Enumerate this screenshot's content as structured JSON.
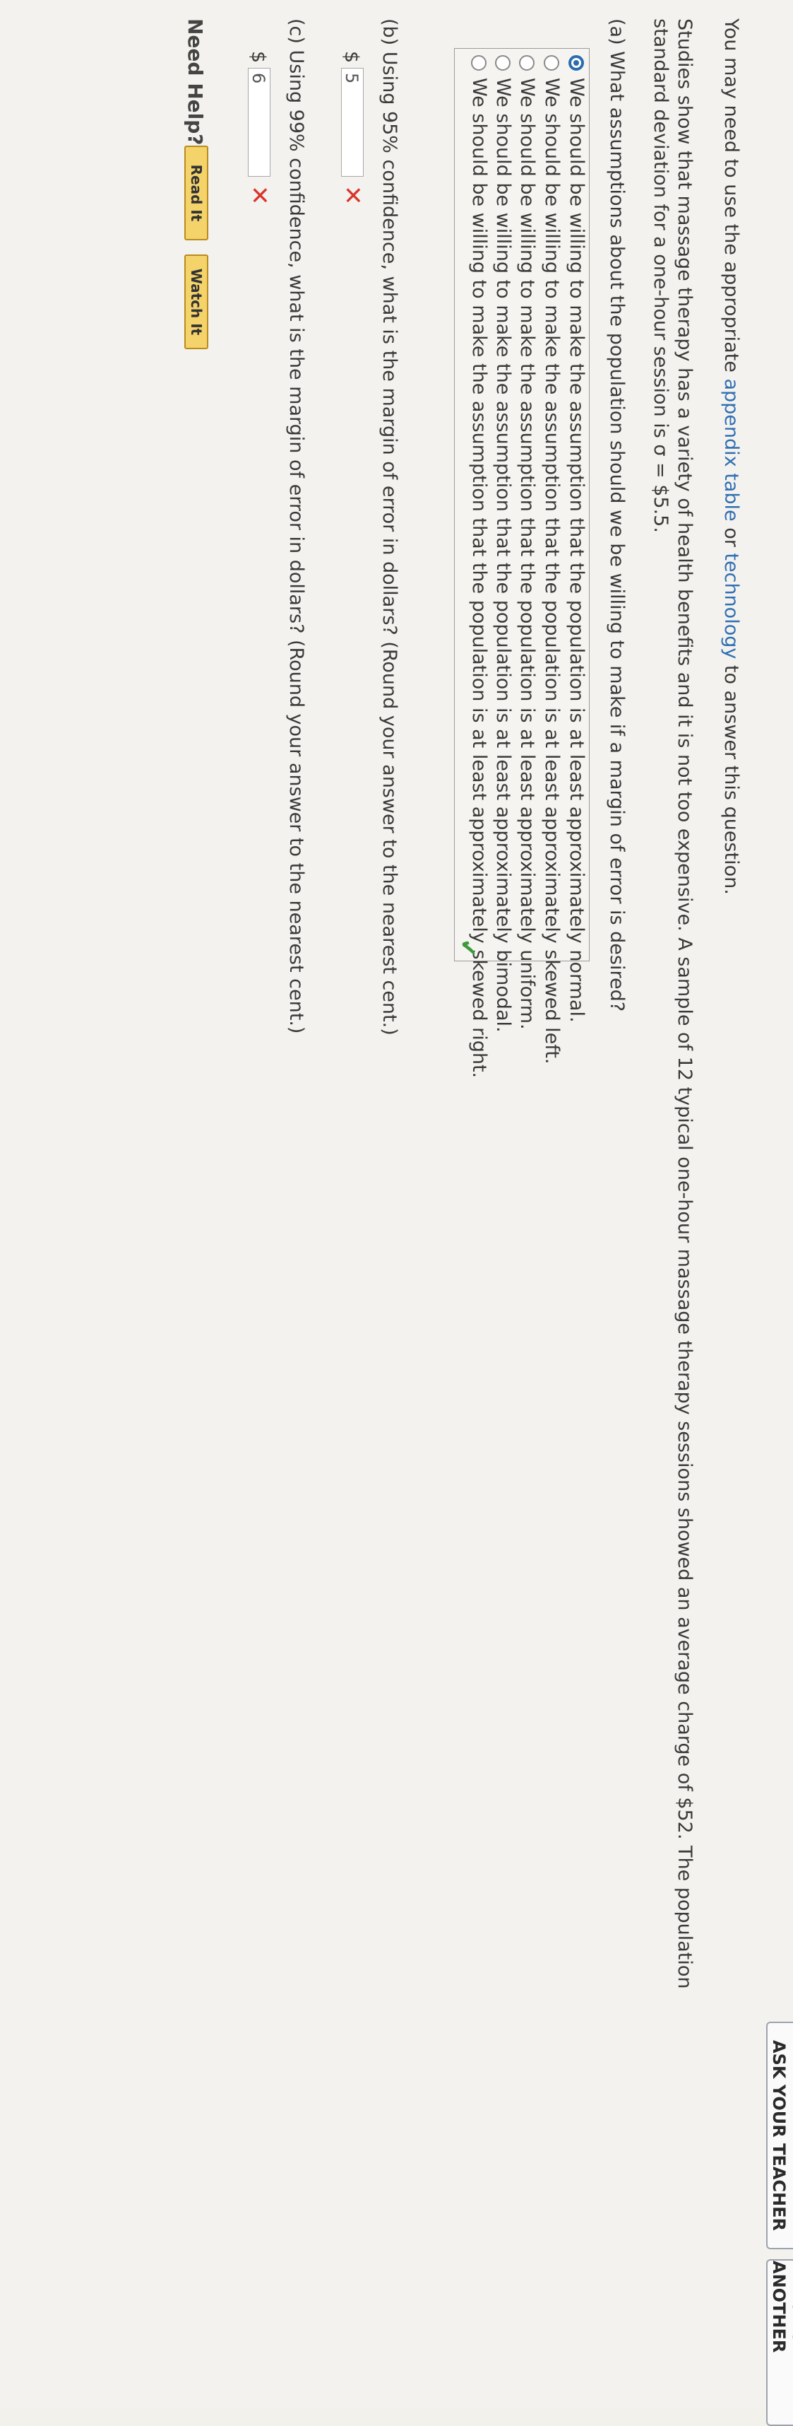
{
  "header": {
    "buttons": [
      "ASK YOUR TEACHER",
      "PRACTICE ANOTHER"
    ]
  },
  "intro": {
    "prefix": "You may need to use the appropriate ",
    "link1": "appendix table",
    "mid": " or ",
    "link2": "technology",
    "suffix": " to answer this question."
  },
  "problem": {
    "line1": "Studies show that massage therapy has a variety of health benefits and it is not too expensive. A sample of 12 typical one-hour massage therapy sessions showed an average charge of $52. The population",
    "line2": "standard deviation for a one-hour session is σ = $5.5."
  },
  "part_a": {
    "question": "(a)  What assumptions about the population should we be willing to make if a margin of error is desired?",
    "options": [
      "We should be willing to make the assumption that the population is at least approximately normal.",
      "We should be willing to make the assumption that the population is at least approximately skewed left.",
      "We should be willing to make the assumption that the population is at least approximately uniform.",
      "We should be willing to make the assumption that the population is at least approximately bimodal.",
      "We should be willing to make the assumption that the population is at least approximately skewed right."
    ],
    "selected_index": 0,
    "status": "correct"
  },
  "part_b": {
    "question": "(b)  Using 95% confidence, what is the margin of error in dollars? (Round your answer to the nearest cent.)",
    "currency": "$",
    "value": "5",
    "status": "incorrect"
  },
  "part_c": {
    "question": "(c)  Using 99% confidence, what is the margin of error in dollars? (Round your answer to the nearest cent.)",
    "currency": "$",
    "value": "6",
    "status": "incorrect"
  },
  "help": {
    "label": "Need Help?",
    "buttons": [
      "Read It",
      "Watch It"
    ]
  },
  "colors": {
    "link": "#2f6fb3",
    "selected_radio": "#2b6cb0",
    "incorrect": "#d9352b",
    "correct": "#3c9a3c",
    "help_button": "#f4d36a"
  }
}
